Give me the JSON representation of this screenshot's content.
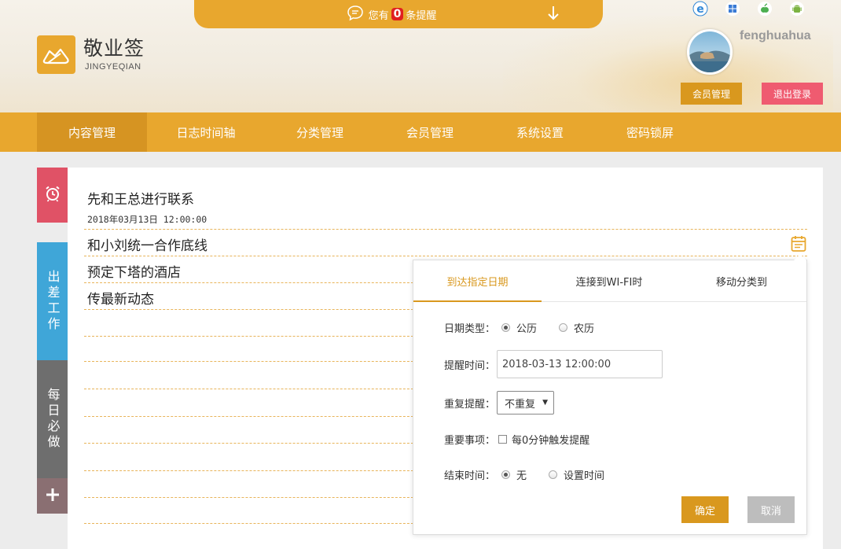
{
  "notice": {
    "prefix": "您有",
    "count": "0",
    "suffix": "条提醒"
  },
  "app": {
    "title": "敬业签",
    "subtitle": "JINGYEQIAN"
  },
  "user": {
    "name": "fenghuahua",
    "member_btn": "会员管理",
    "logout_btn": "退出登录"
  },
  "platforms": [
    "ie-icon",
    "windows-icon",
    "apple-icon",
    "android-icon"
  ],
  "nav": [
    {
      "label": "内容管理",
      "active": true
    },
    {
      "label": "日志时间轴"
    },
    {
      "label": "分类管理"
    },
    {
      "label": "会员管理"
    },
    {
      "label": "系统设置"
    },
    {
      "label": "密码锁屏"
    }
  ],
  "sidebar": {
    "trip": "出差工作",
    "daily": "每日必做"
  },
  "items": [
    {
      "text": "先和王总进行联系",
      "date": "2018年03月13日 12:00:00"
    },
    {
      "text": "和小刘统一合作底线"
    },
    {
      "text": "预定下塔的酒店"
    },
    {
      "text": "传最新动态"
    }
  ],
  "popup": {
    "tabs": [
      "到达指定日期",
      "连接到WI-FI时",
      "移动分类到"
    ],
    "date_type_label": "日期类型：",
    "date_type_options": [
      "公历",
      "农历"
    ],
    "remind_time_label": "提醒时间：",
    "remind_time_value": "2018-03-13 12:00:00",
    "repeat_label": "重复提醒：",
    "repeat_value": "不重复",
    "important_label": "重要事项：",
    "important_option": "每0分钟触发提醒",
    "end_time_label": "结束时间：",
    "end_options": [
      "无",
      "设置时间"
    ],
    "ok": "确定",
    "cancel": "取消"
  },
  "colors": {
    "accent": "#e8a72e",
    "accent_dark": "#d9981e",
    "logout": "#ef5b70",
    "alarm": "#e05266",
    "trip": "#3fa6d8",
    "daily": "#6e6e6e"
  }
}
